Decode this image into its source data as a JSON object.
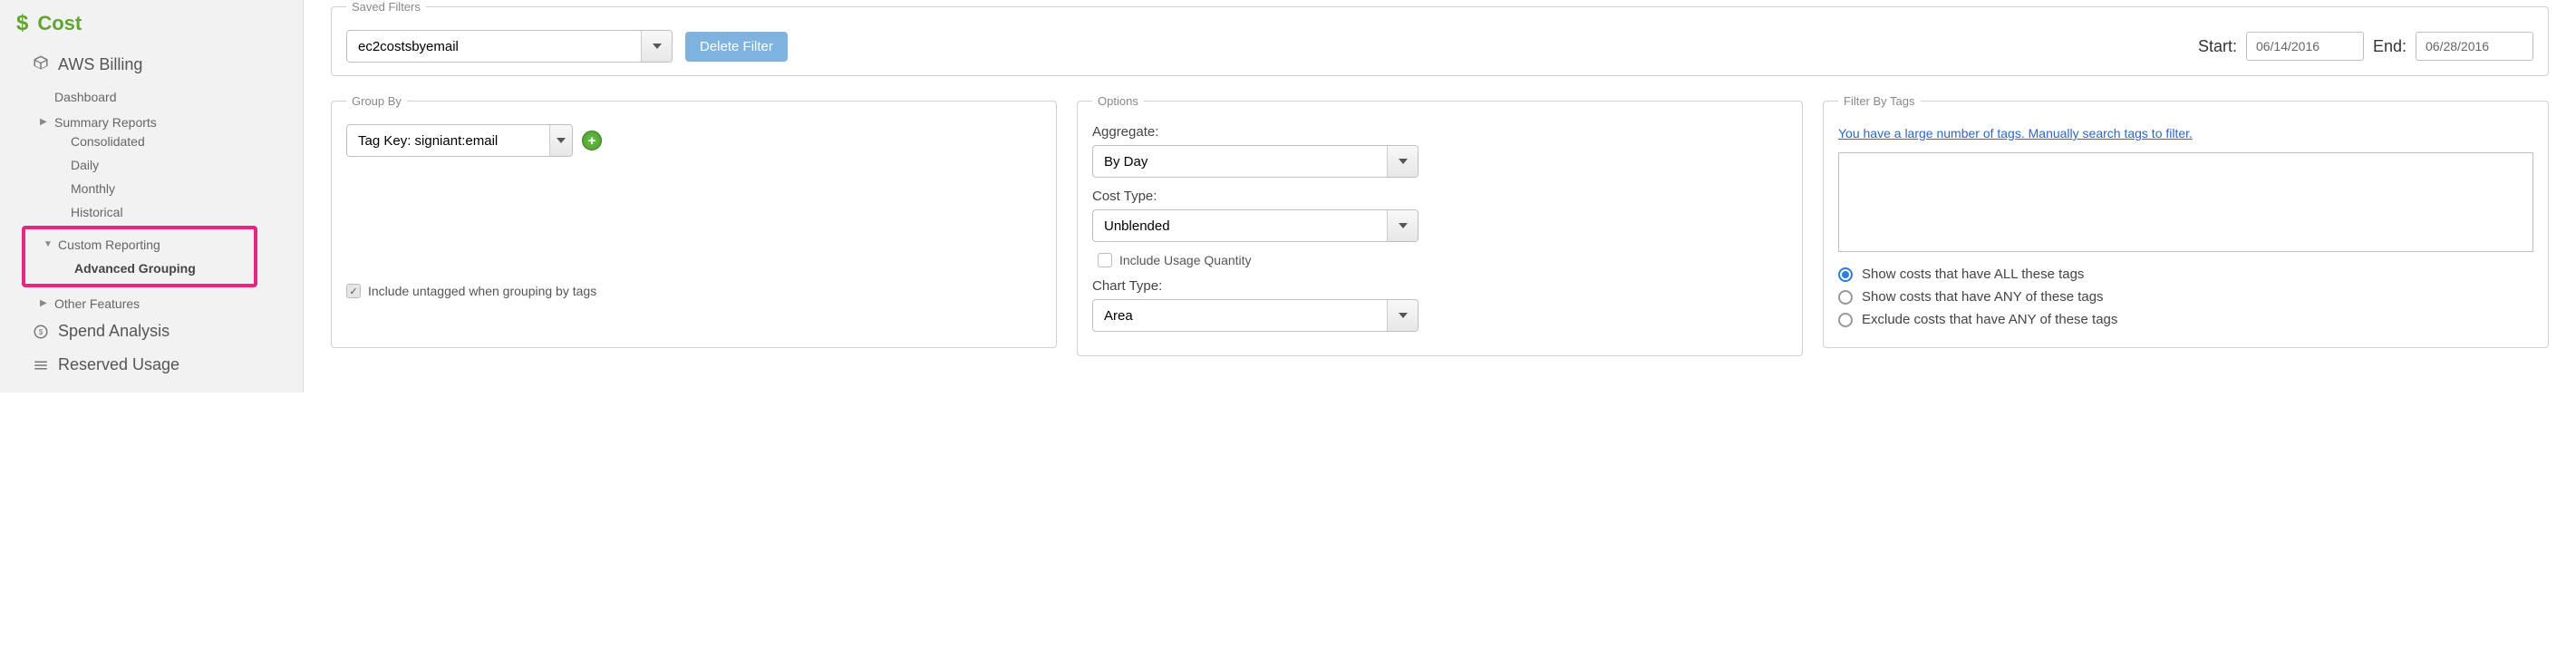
{
  "sidebar": {
    "title": "Cost",
    "billing_label": "AWS Billing",
    "dashboard_label": "Dashboard",
    "summary_label": "Summary Reports",
    "summary_items": {
      "consolidated": "Consolidated",
      "daily": "Daily",
      "monthly": "Monthly",
      "historical": "Historical"
    },
    "custom_label": "Custom Reporting",
    "advanced_label": "Advanced Grouping",
    "other_features_label": "Other Features",
    "spend_label": "Spend Analysis",
    "reserved_label": "Reserved Usage"
  },
  "saved_filters": {
    "legend": "Saved Filters",
    "value": "ec2costsbyemail",
    "delete_label": "Delete Filter",
    "start_label": "Start:",
    "start_value": "06/14/2016",
    "end_label": "End:",
    "end_value": "06/28/2016"
  },
  "group_by": {
    "legend": "Group By",
    "value": "Tag Key: signiant:email",
    "checkbox_label": "Include untagged when grouping by tags",
    "checkbox_checked": true
  },
  "options": {
    "legend": "Options",
    "aggregate_label": "Aggregate:",
    "aggregate_value": "By Day",
    "cost_type_label": "Cost Type:",
    "cost_type_value": "Unblended",
    "include_usage_label": "Include Usage Quantity",
    "include_usage_checked": false,
    "chart_type_label": "Chart Type:",
    "chart_type_value": "Area"
  },
  "filter_tags": {
    "legend": "Filter By Tags",
    "link_text": "You have a large number of tags. Manually search tags to filter.",
    "radios": {
      "all": "Show costs that have ALL these tags",
      "any": "Show costs that have ANY of these tags",
      "exclude": "Exclude costs that have ANY of these tags"
    },
    "selected": "all"
  }
}
